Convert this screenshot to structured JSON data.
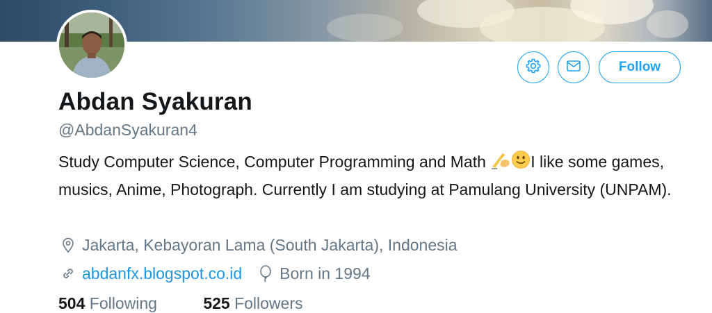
{
  "profile": {
    "name": "Abdan Syakuran",
    "handle": "@AbdanSyakuran4",
    "bio_before_emoji": "Study Computer Science, Computer Programming and Math ",
    "bio_after_emoji": "I like some games, musics, Anime, Photograph. Currently I am studying at Pamulang University (UNPAM).",
    "bio_emojis": [
      "writing-hand-emoji",
      "slightly-smiling-face-emoji"
    ],
    "location": "Jakarta, Kebayoran Lama (South Jakarta), Indonesia",
    "website": "abdanfx.blogspot.co.id",
    "birth": "Born in 1994"
  },
  "actions": {
    "settings_icon": "gear-icon",
    "message_icon": "envelope-icon",
    "follow_label": "Follow"
  },
  "stats": {
    "following_count": "504",
    "following_label": "Following",
    "followers_count": "525",
    "followers_label": "Followers"
  },
  "colors": {
    "accent": "#1da1f2",
    "link": "#1b95e0",
    "secondary_text": "#657786",
    "primary_text": "#14171a"
  }
}
